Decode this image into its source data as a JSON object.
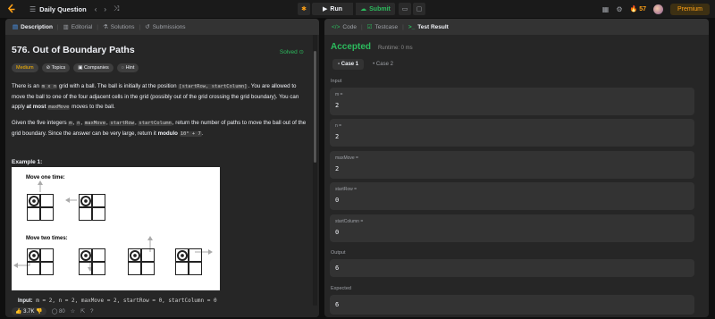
{
  "topbar": {
    "title": "Daily Question",
    "run_label": "Run",
    "submit_label": "Submit",
    "streak": "57",
    "premium_label": "Premium"
  },
  "left": {
    "tabs": [
      "Description",
      "Editorial",
      "Solutions",
      "Submissions"
    ],
    "problem_title": "576. Out of Boundary Paths",
    "solved_label": "Solved",
    "tags": [
      "Medium",
      "Topics",
      "Companies",
      "Hint"
    ],
    "desc1_a": "There is an ",
    "desc1_code1": "m x n",
    "desc1_b": " grid with a ball. The ball is initially at the position ",
    "desc1_code2": "[startRow, startColumn]",
    "desc1_c": ". You are allowed to move the ball to one of the four adjacent cells in the grid (possibly out of the grid crossing the grid boundary). You can apply ",
    "desc1_bold": "at most",
    "desc1_code3": "maxMove",
    "desc1_d": " moves to the ball.",
    "desc2_a": "Given the five integers ",
    "desc2_code1": "m",
    "desc2_code2": "n",
    "desc2_code3": "maxMove",
    "desc2_code4": "startRow",
    "desc2_code5": "startColumn",
    "desc2_b": ", return the number of paths to move the ball out of the grid boundary. Since the answer can be very large, return it ",
    "desc2_bold": "modulo",
    "desc2_code6": "10⁹ + 7",
    "example_title": "Example 1:",
    "img_label1": "Move one time:",
    "img_label2": "Move two times:",
    "input_line_prefix": "Input:",
    "input_line": "m = 2, n = 2, maxMove = 2, startRow = 0, startColumn = 0",
    "likes": "3.7K",
    "comments": "80"
  },
  "right": {
    "tabs": [
      "Code",
      "Testcase",
      "Test Result"
    ],
    "status": "Accepted",
    "runtime": "Runtime: 0 ms",
    "cases": [
      "Case 1",
      "Case 2"
    ],
    "input_label": "Input",
    "params": [
      {
        "name": "m =",
        "value": "2"
      },
      {
        "name": "n =",
        "value": "2"
      },
      {
        "name": "maxMove =",
        "value": "2"
      },
      {
        "name": "startRow =",
        "value": "0"
      },
      {
        "name": "startColumn =",
        "value": "0"
      }
    ],
    "output_label": "Output",
    "output_value": "6",
    "expected_label": "Expected",
    "expected_value": "6"
  },
  "colors": {
    "accent_green": "#2cbb5d",
    "medium_yellow": "#ffb800",
    "premium_orange": "#ffa116"
  }
}
